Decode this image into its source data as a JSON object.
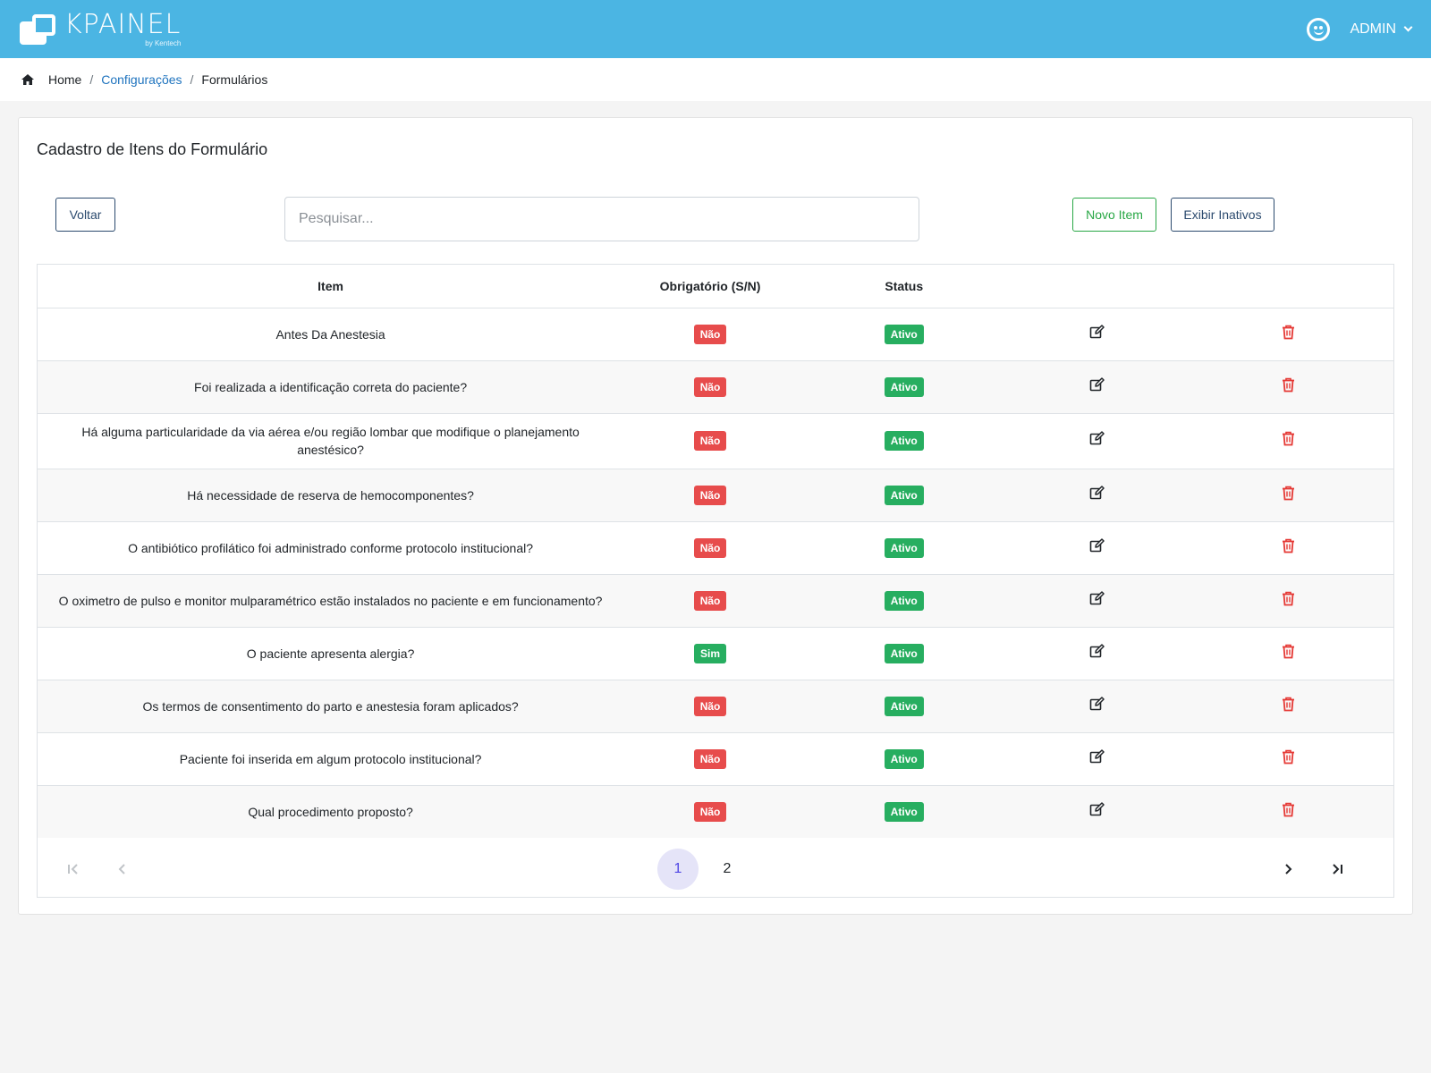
{
  "app": {
    "brand": "KPAINEL",
    "brand_by": "by Kentech",
    "user_label": "ADMIN"
  },
  "breadcrumb": {
    "home": "Home",
    "config": "Configurações",
    "current": "Formulários",
    "separator": "/"
  },
  "card": {
    "title": "Cadastro de Itens do Formulário"
  },
  "toolbar": {
    "back_label": "Voltar",
    "search_placeholder": "Pesquisar...",
    "new_item_label": "Novo Item",
    "show_inactive_label": "Exibir Inativos"
  },
  "table": {
    "headers": {
      "item": "Item",
      "required": "Obrigatório (S/N)",
      "status": "Status"
    },
    "rows": [
      {
        "item": "Antes Da Anestesia",
        "required": "Não",
        "status": "Ativo"
      },
      {
        "item": "Foi realizada a identificação correta do paciente?",
        "required": "Não",
        "status": "Ativo"
      },
      {
        "item": "Há alguma particularidade da via aérea e/ou região lombar que modifique o planejamento anestésico?",
        "required": "Não",
        "status": "Ativo"
      },
      {
        "item": "Há necessidade de reserva de hemocomponentes?",
        "required": "Não",
        "status": "Ativo"
      },
      {
        "item": "O antibiótico profilático foi administrado conforme protocolo institucional?",
        "required": "Não",
        "status": "Ativo"
      },
      {
        "item": "O oximetro de pulso e monitor mulparamétrico estão instalados no paciente e em funcionamento?",
        "required": "Não",
        "status": "Ativo"
      },
      {
        "item": "O paciente apresenta alergia?",
        "required": "Sim",
        "status": "Ativo"
      },
      {
        "item": "Os termos de consentimento do parto e anestesia foram aplicados?",
        "required": "Não",
        "status": "Ativo"
      },
      {
        "item": "Paciente foi inserida em algum protocolo institucional?",
        "required": "Não",
        "status": "Ativo"
      },
      {
        "item": "Qual procedimento proposto?",
        "required": "Não",
        "status": "Ativo"
      }
    ]
  },
  "pagination": {
    "pages": [
      "1",
      "2"
    ],
    "current_page": 1
  },
  "colors": {
    "header_bg": "#4bb5e3",
    "badge_no": "#e74c4c",
    "badge_yes": "#27ae60",
    "badge_active": "#27ae60",
    "delete_icon": "#e53935",
    "new_item_accent": "#28a745",
    "active_page_bg": "#e5e4f8"
  },
  "icons": {
    "row_edit": "edit-icon",
    "row_delete": "trash-icon",
    "first_page": "first-page-icon",
    "prev_page": "prev-page-icon",
    "next_page": "next-page-icon",
    "last_page": "last-page-icon",
    "home": "home-icon",
    "user": "smiley-icon"
  }
}
